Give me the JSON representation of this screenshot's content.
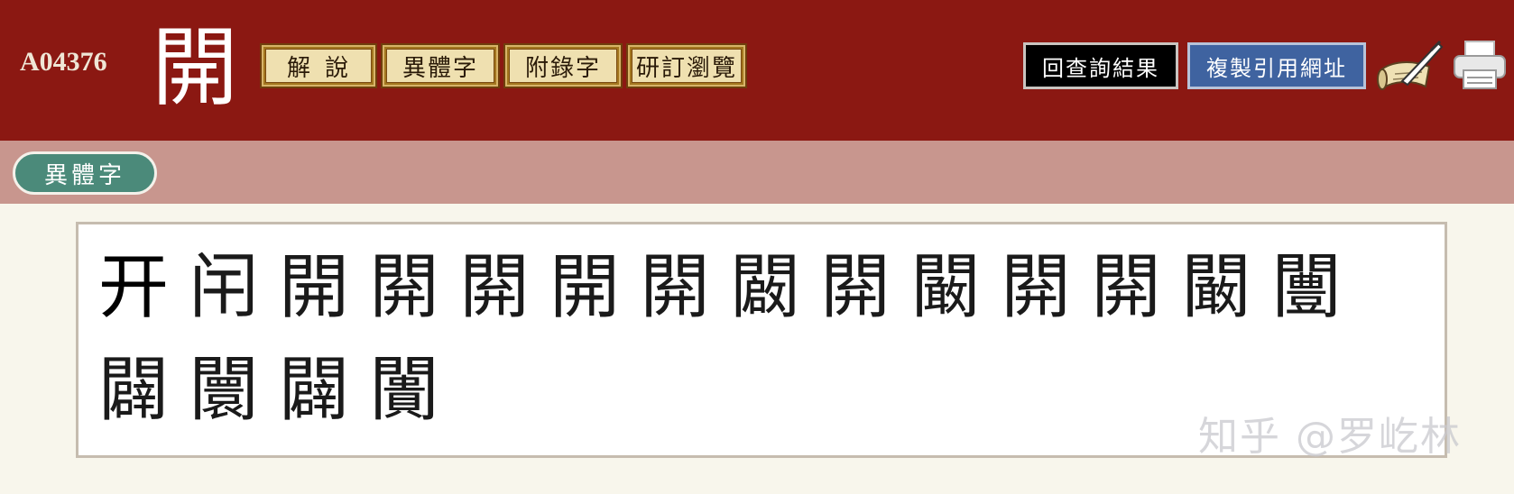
{
  "header": {
    "code": "A04376",
    "main_char": "開",
    "tabs": [
      "解說",
      "異體字",
      "附錄字",
      "研訂瀏覽"
    ],
    "buttons": {
      "back": "回查詢結果",
      "copy": "複製引用網址"
    },
    "icons": {
      "quill": "quill-scroll-icon",
      "print": "printer-icon"
    },
    "colors": {
      "header_bg": "#8b1812",
      "subbar_bg": "#c8968e",
      "pill_bg": "#4b8a7a",
      "copy_btn_bg": "#3f63a0"
    }
  },
  "subbar": {
    "section_label": "異體字"
  },
  "variants": [
    "开",
    "闬",
    "開",
    "閞",
    "閞",
    "開",
    "閞",
    "闙",
    "閞",
    "闞",
    "閞",
    "閞",
    "闞",
    "闦",
    "闢",
    "闤",
    "闢",
    "闠"
  ],
  "watermark": "知乎 @罗屹林"
}
